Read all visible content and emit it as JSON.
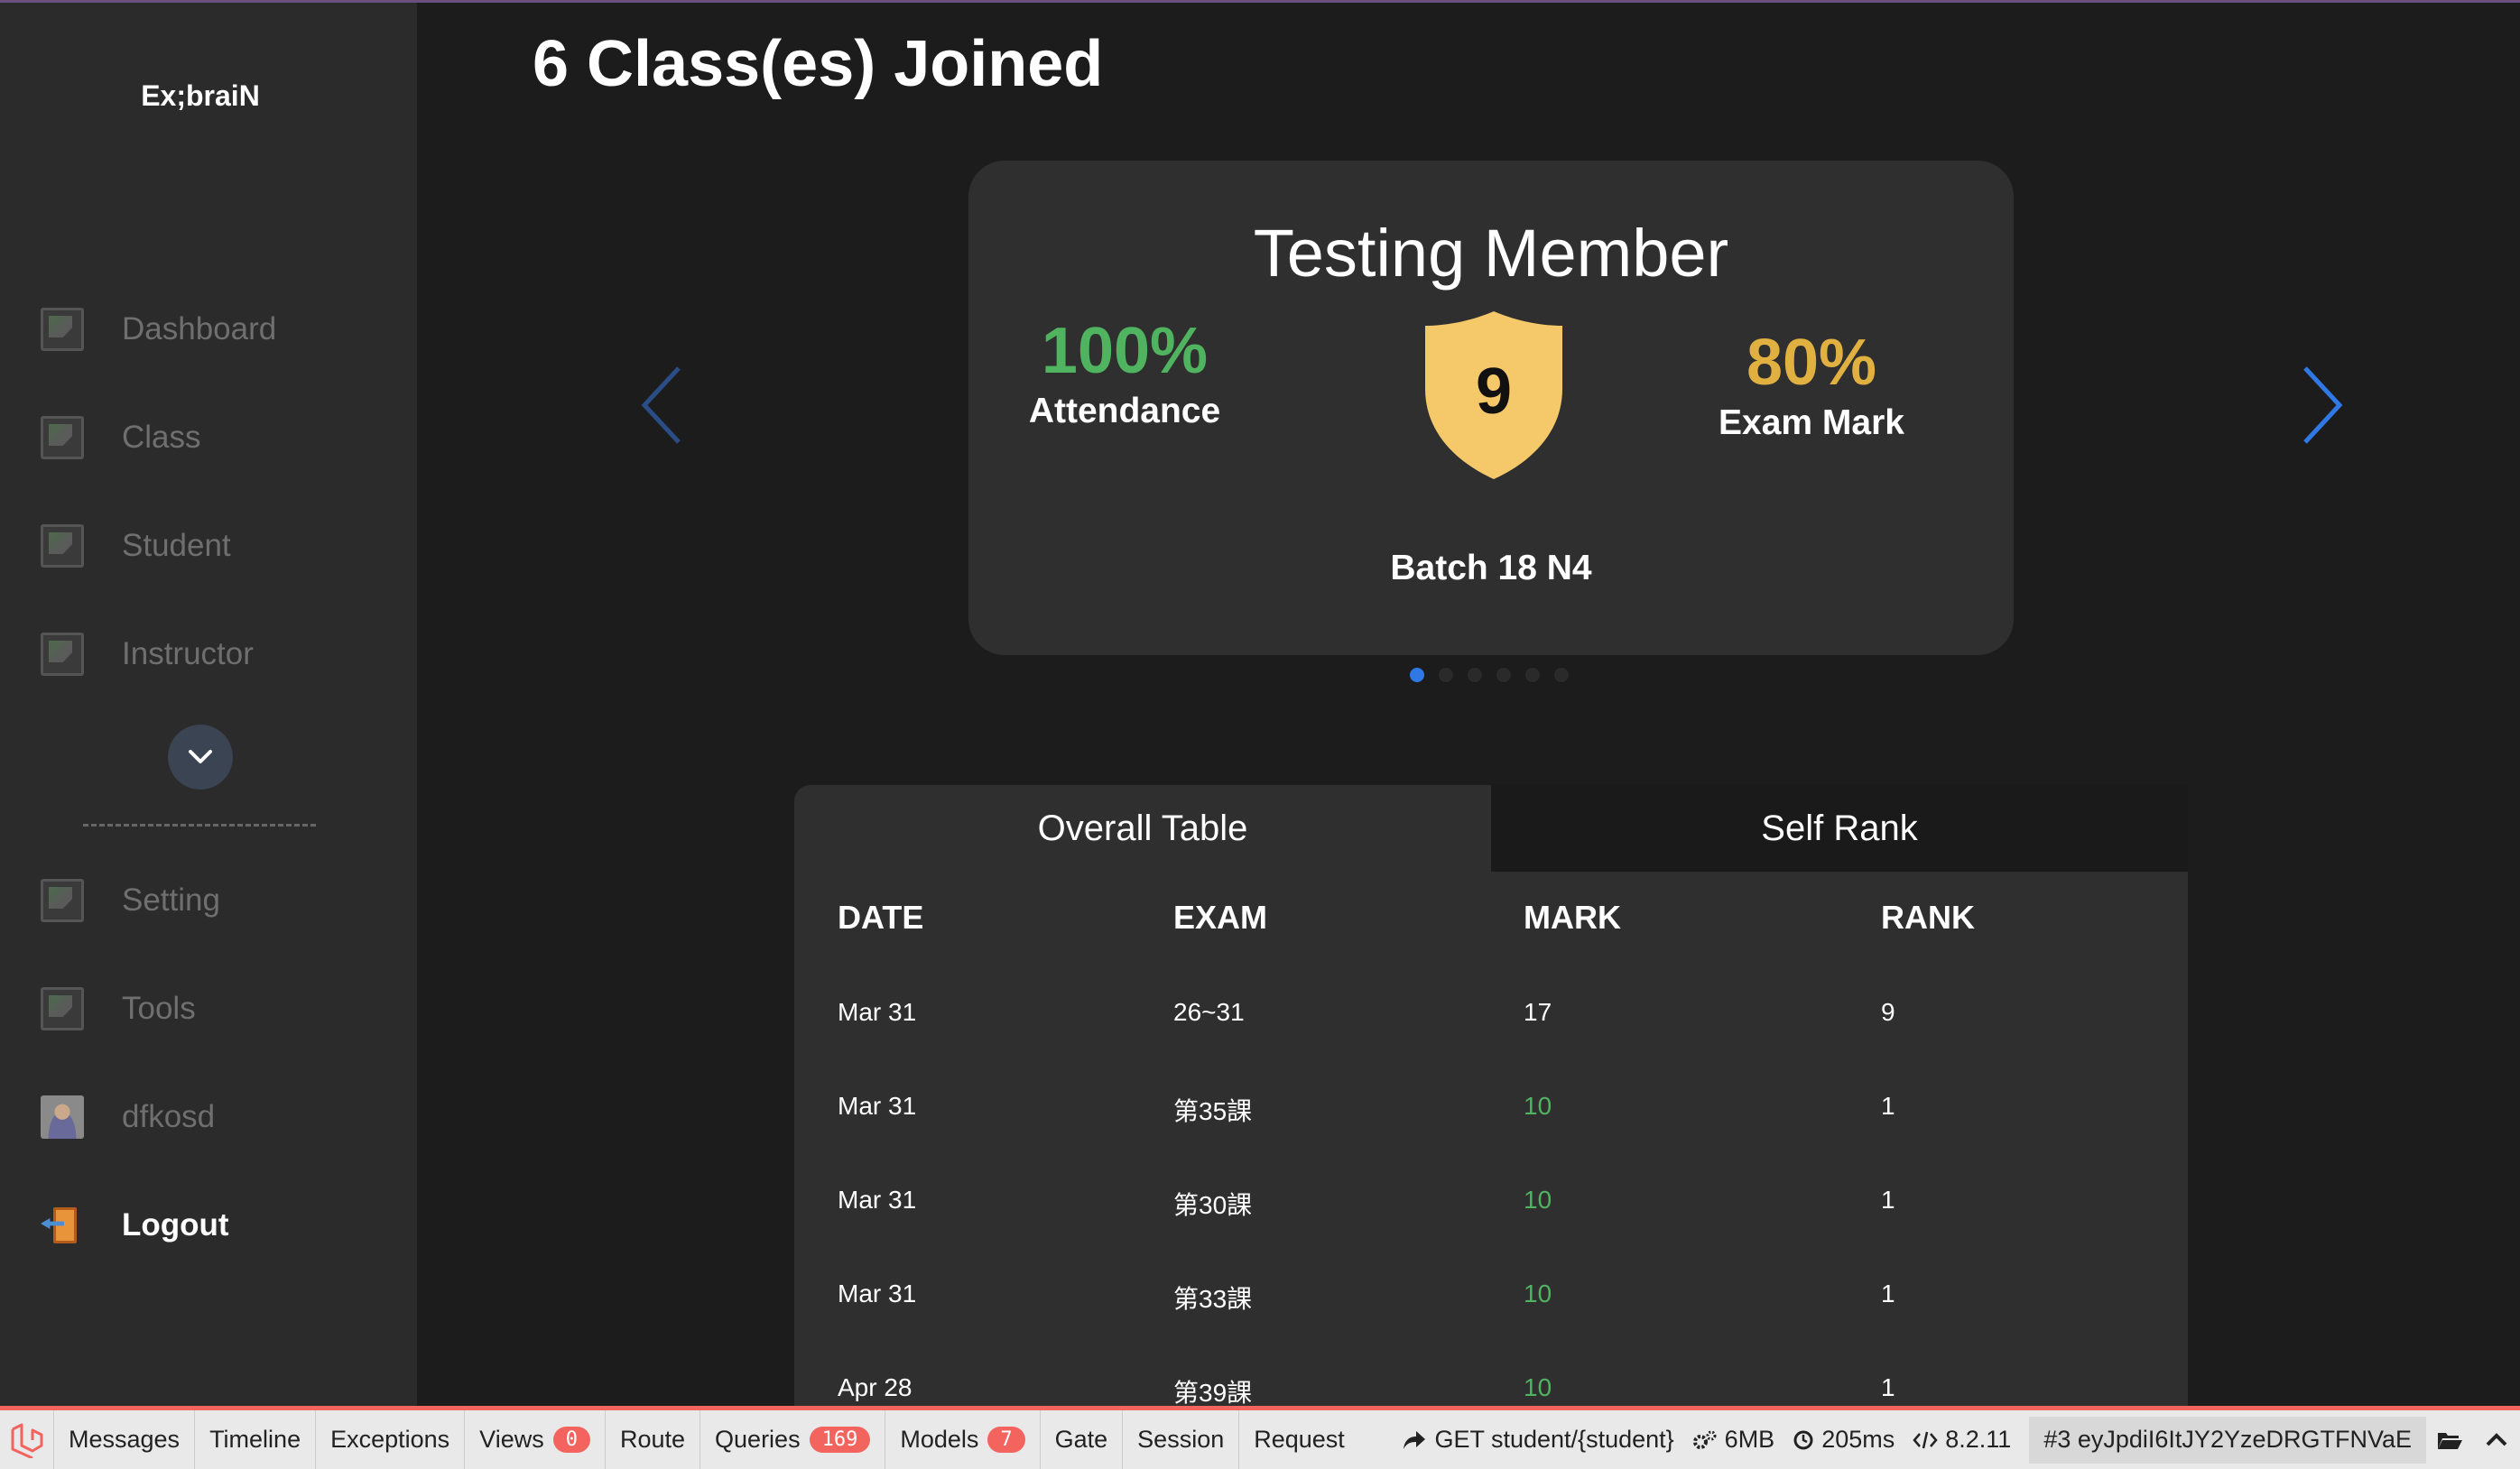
{
  "app": {
    "logo": "Ex;braiN"
  },
  "sidebar": {
    "items": [
      {
        "label": "Dashboard"
      },
      {
        "label": "Class"
      },
      {
        "label": "Student"
      },
      {
        "label": "Instructor"
      }
    ],
    "secondary": [
      {
        "label": "Setting"
      },
      {
        "label": "Tools"
      },
      {
        "label": "dfkosd"
      }
    ],
    "logout_label": "Logout"
  },
  "main": {
    "title": "6 Class(es) Joined",
    "card": {
      "title": "Testing Member",
      "attendance_value": "100%",
      "attendance_label": "Attendance",
      "rank_badge": "9",
      "exam_value": "80%",
      "exam_label": "Exam Mark",
      "batch": "Batch 18 N4"
    },
    "carousel": {
      "total": 6,
      "active_index": 0
    },
    "tabs": [
      {
        "label": "Overall Table",
        "active": true
      },
      {
        "label": "Self Rank",
        "active": false
      }
    ],
    "table": {
      "headers": [
        "DATE",
        "EXAM",
        "MARK",
        "RANK"
      ],
      "rows": [
        {
          "date": "Mar 31",
          "exam": "26~31",
          "mark": "17",
          "rank": "9",
          "highlight": false
        },
        {
          "date": "Mar 31",
          "exam": "第35課",
          "mark": "10",
          "rank": "1",
          "highlight": true
        },
        {
          "date": "Mar 31",
          "exam": "第30課",
          "mark": "10",
          "rank": "1",
          "highlight": true
        },
        {
          "date": "Mar 31",
          "exam": "第33課",
          "mark": "10",
          "rank": "1",
          "highlight": true
        },
        {
          "date": "Apr 28",
          "exam": "第39課",
          "mark": "10",
          "rank": "1",
          "highlight": true
        }
      ]
    }
  },
  "debugbar": {
    "tabs": [
      {
        "label": "Messages"
      },
      {
        "label": "Timeline"
      },
      {
        "label": "Exceptions"
      },
      {
        "label": "Views",
        "badge": "0"
      },
      {
        "label": "Route"
      },
      {
        "label": "Queries",
        "badge": "169"
      },
      {
        "label": "Models",
        "badge": "7"
      },
      {
        "label": "Gate"
      },
      {
        "label": "Session"
      },
      {
        "label": "Request"
      }
    ],
    "route": "GET student/{student}",
    "memory": "6MB",
    "time": "205ms",
    "php_version": "8.2.11",
    "request_id": "#3 eyJpdiI6ItJY2YzeDRGTFNVaE"
  },
  "colors": {
    "accent_green": "#4fb35f",
    "accent_gold": "#e0b040",
    "accent_blue": "#2f78e6",
    "debug_red": "#f4645f"
  }
}
